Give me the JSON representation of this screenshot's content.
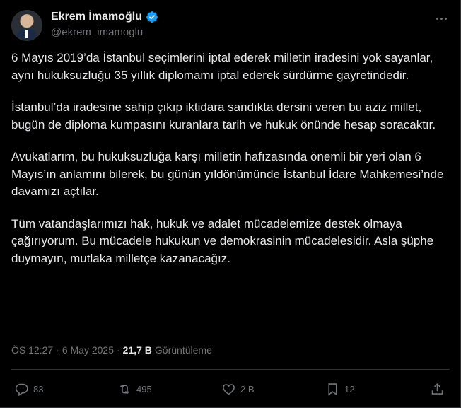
{
  "author": {
    "name": "Ekrem İmamoğlu",
    "handle": "@ekrem_imamoglu"
  },
  "tweet": {
    "paragraphs": [
      "6 Mayıs 2019’da İstanbul seçimlerini iptal ederek milletin iradesini yok sayanlar, aynı hukuksuzluğu 35 yıllık diplomamı iptal ederek sürdürme gayretindedir.",
      "İstanbul’da iradesine sahip çıkıp iktidara sandıkta dersini veren bu aziz millet, bugün de diploma kumpasını kuranlara tarih ve hukuk önünde hesap soracaktır.",
      "Avukatlarım, bu hukuksuzluğa karşı milletin hafızasında önemli bir yeri olan 6 Mayıs’ın anlamını bilerek, bu günün yıldönümünde İstanbul İdare Mahkemesi’nde davamızı açtılar.",
      "Tüm vatandaşlarımızı hak, hukuk ve adalet mücadelemize destek olmaya çağırıyorum. Bu mücadele hukukun ve demokrasinin mücadelesidir. Asla şüphe duymayın, mutlaka milletçe kazanacağız."
    ]
  },
  "meta": {
    "time": "ÖS 12:27",
    "separator": "·",
    "date": "6 May 2025",
    "views_count": "21,7 B",
    "views_label": "Görüntüleme"
  },
  "actions": {
    "replies": "83",
    "reposts": "495",
    "likes": "2 B",
    "bookmarks": "12"
  },
  "colors": {
    "background": "#000000",
    "text": "#e7e9ea",
    "muted": "#71767b",
    "verified": "#1d9bf0",
    "divider": "#2f3336"
  },
  "icons": [
    "verified-badge-icon",
    "more-icon",
    "reply-icon",
    "repost-icon",
    "like-icon",
    "bookmark-icon",
    "share-icon"
  ]
}
